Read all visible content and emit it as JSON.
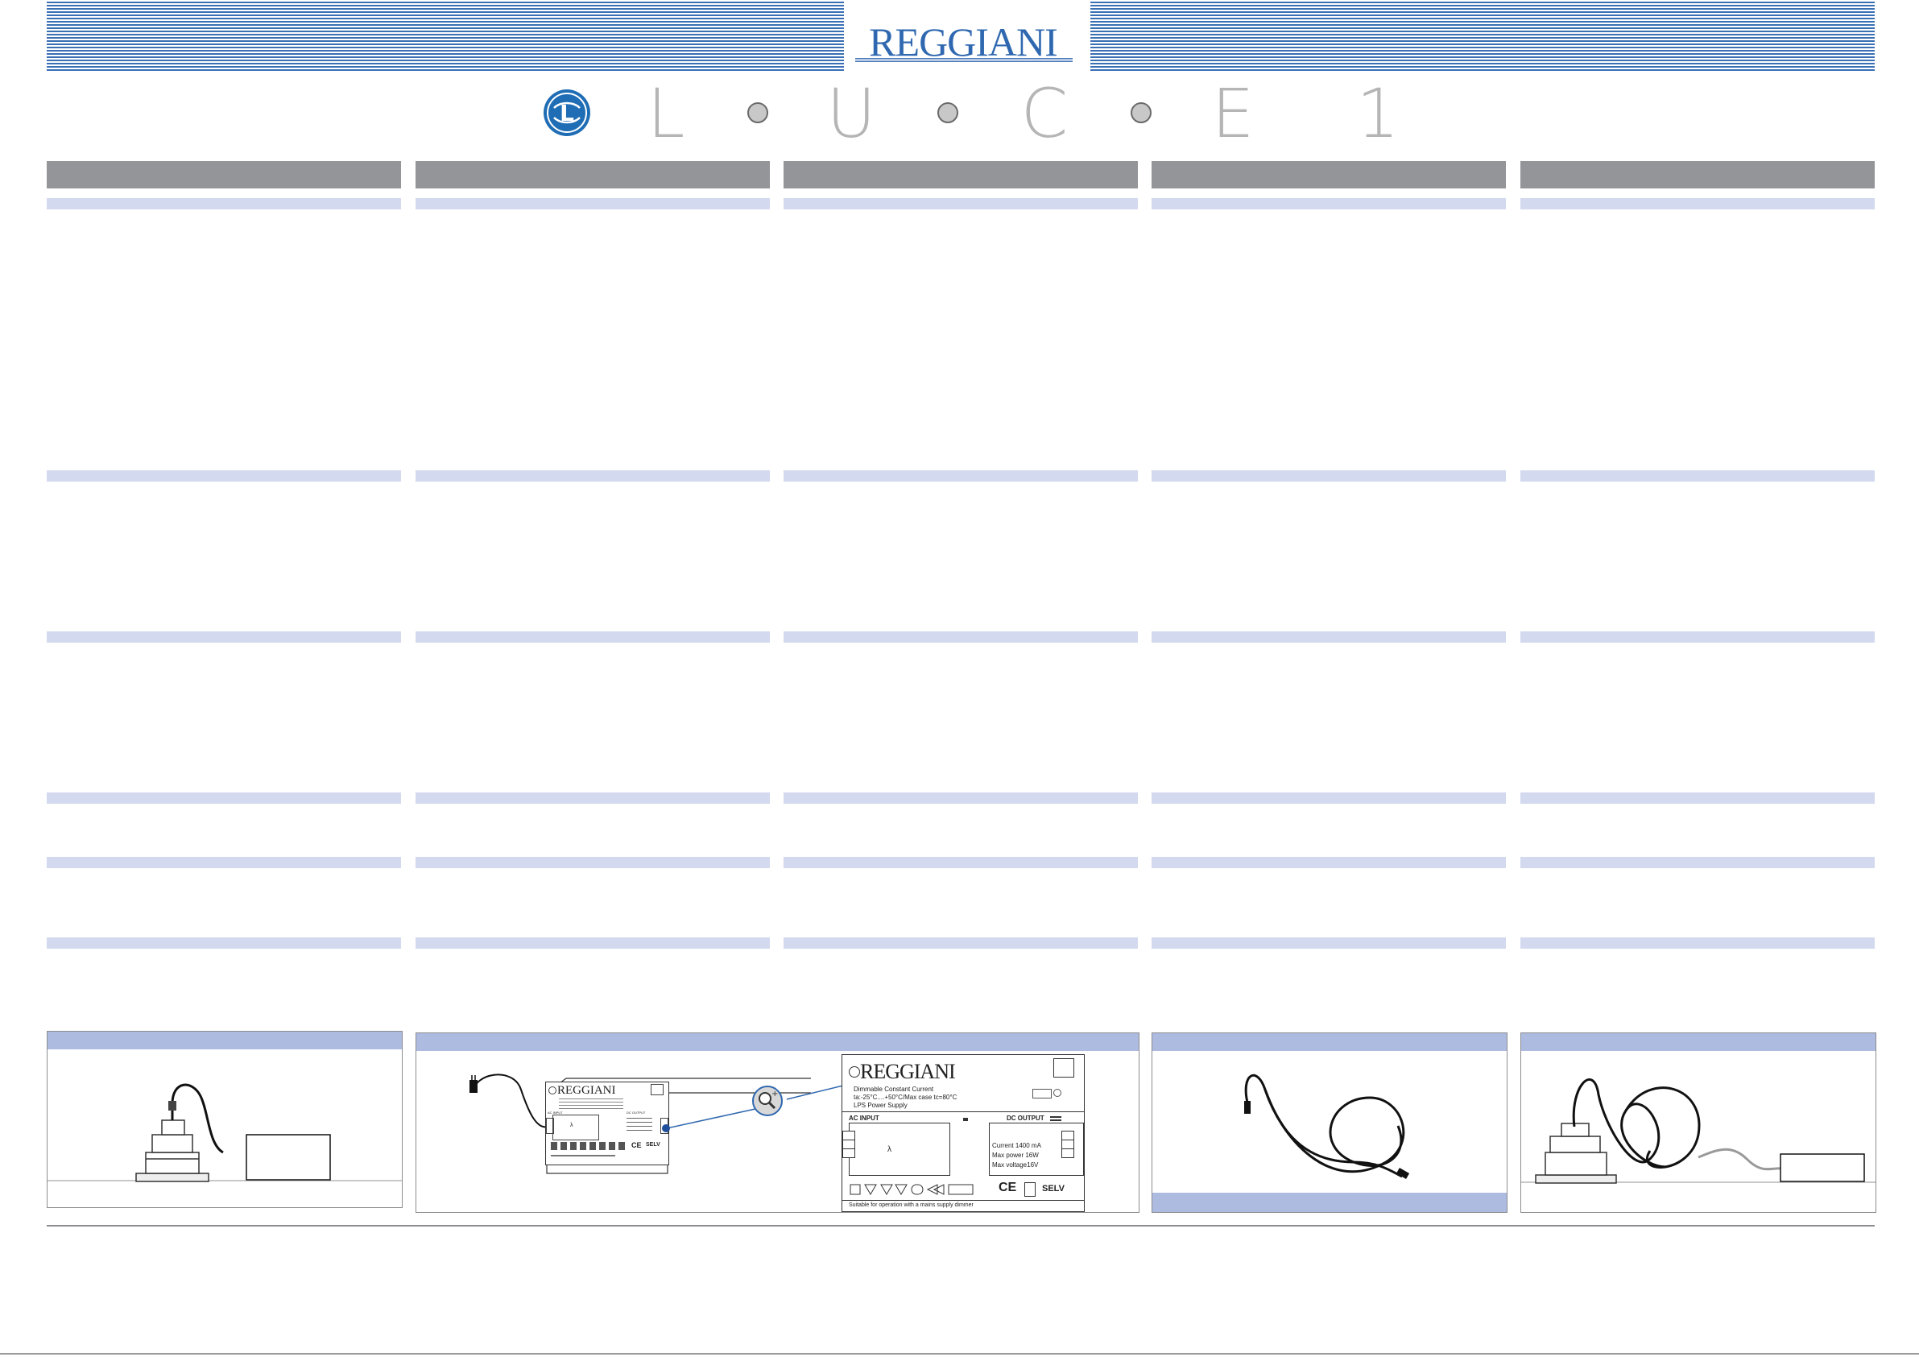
{
  "brand": {
    "name": "REGGIANI",
    "primary_color": "#3a6fb4",
    "product_letters": [
      "L",
      "U",
      "C",
      "E",
      "1"
    ],
    "emblem_letter": "L"
  },
  "columns": [
    {
      "id": "col-1",
      "header": ""
    },
    {
      "id": "col-2",
      "header": ""
    },
    {
      "id": "col-3",
      "header": ""
    },
    {
      "id": "col-4",
      "header": ""
    },
    {
      "id": "col-5",
      "header": ""
    }
  ],
  "label_plate": {
    "brand": "REGGIANI",
    "line1": "Dimmable Constant Current",
    "line2": "ta:-25°C....+50°C/Max case tc=80°C",
    "line3": "LPS Power Supply",
    "ac_input": "AC INPUT",
    "dc_output": "DC OUTPUT",
    "current": "Current 1400 mA",
    "max_power": "Max power 16W",
    "max_voltage": "Max voltage16V",
    "lambda": "λ",
    "selv": "SELV",
    "ce": "CE",
    "footer": "Suitable for operation with a mains supply dimmer"
  },
  "small_device": {
    "brand": "REGGIANI",
    "selv": "SELV",
    "ce": "CE",
    "lambda": "λ",
    "ac_input": "AC INPUT",
    "dc_output": "DC OUTPUT"
  },
  "icons": [
    "luce-emblem-icon",
    "magnifier-icon",
    "plug-icon",
    "cable-icon",
    "lamp-fixture-icon"
  ]
}
